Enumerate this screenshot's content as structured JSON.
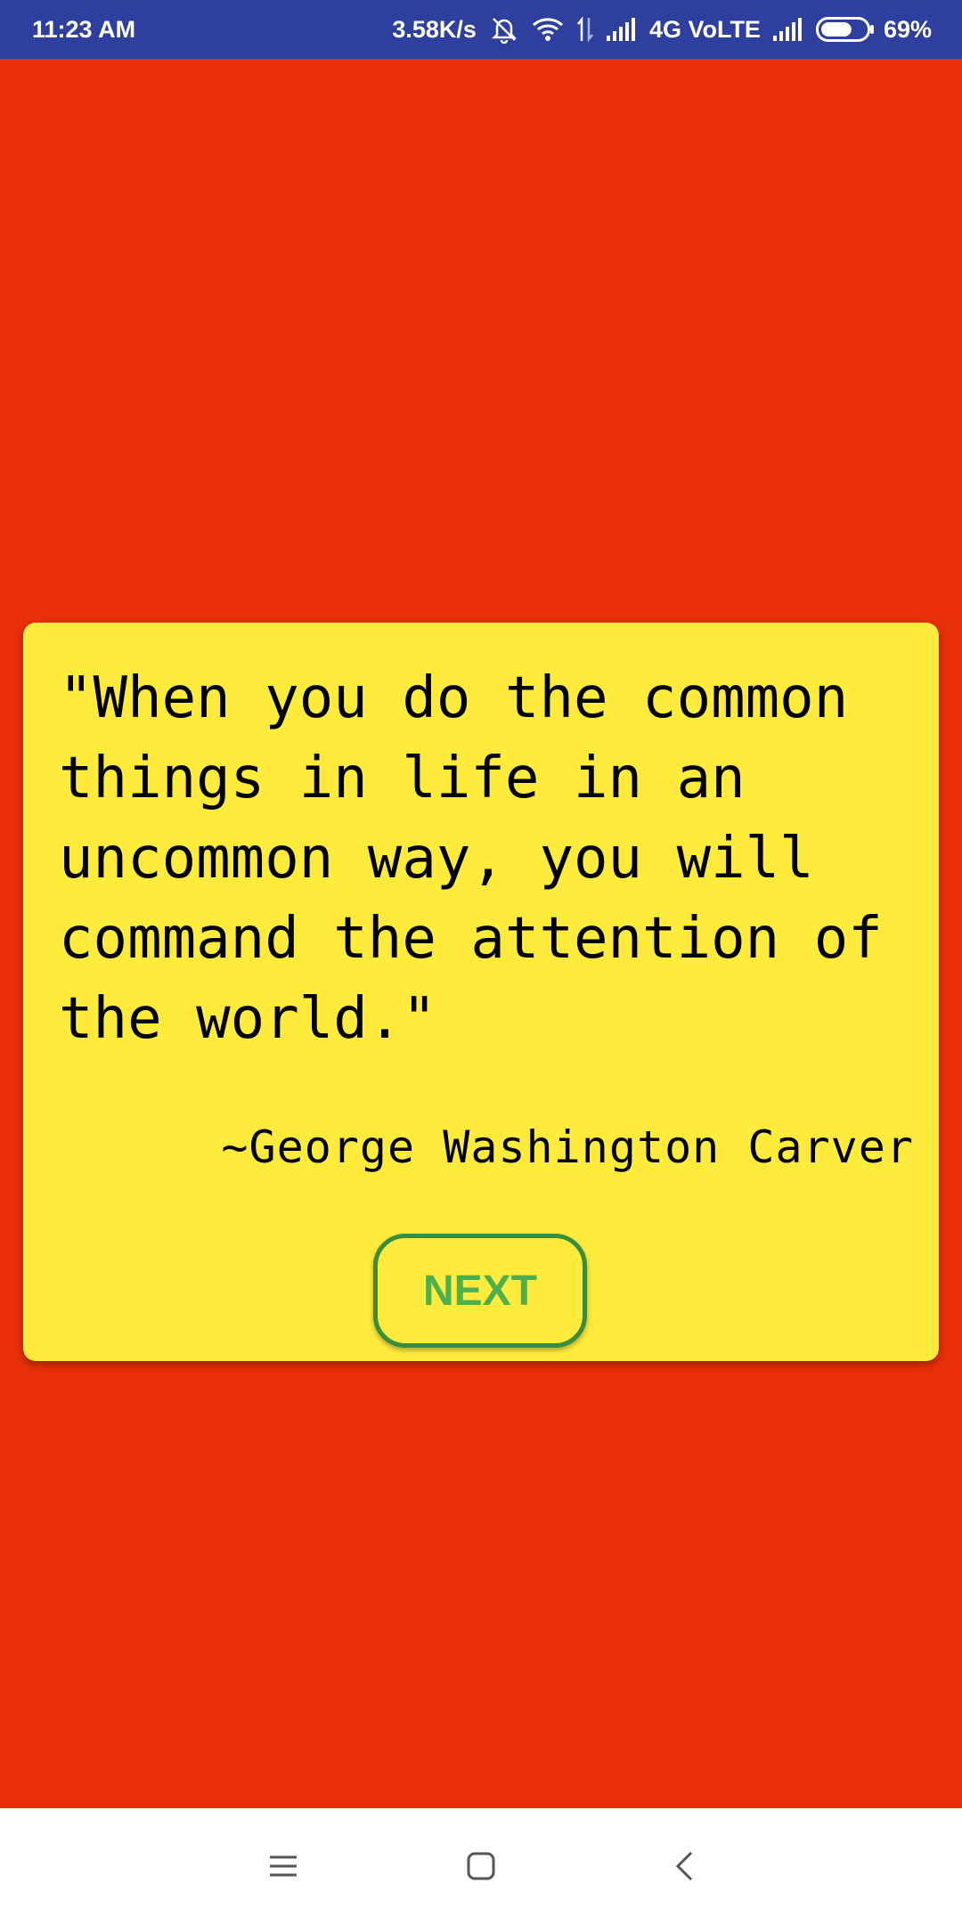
{
  "status_bar": {
    "time": "11:23 AM",
    "net_speed": "3.58K/s",
    "network_label": "4G VoLTE",
    "battery_percent": "69%",
    "battery_level": 0.69,
    "icons": [
      "mute-icon",
      "wifi-icon",
      "data-transfer-icon",
      "signal-icon",
      "signal-icon",
      "battery-icon"
    ]
  },
  "colors": {
    "status_bar": "#2e3f9e",
    "background": "#ea300a",
    "card": "#ffeb3b",
    "button_text": "#4caf50",
    "button_border": "#388e3c"
  },
  "quote": {
    "text": "\"When you do the common things in life in an uncommon way, you will command the attention of the world.\"",
    "author": "~George Washington Carver"
  },
  "actions": {
    "next_label": "NEXT"
  },
  "nav_bar": {
    "icons": [
      "menu-icon",
      "home-icon",
      "back-icon"
    ]
  }
}
